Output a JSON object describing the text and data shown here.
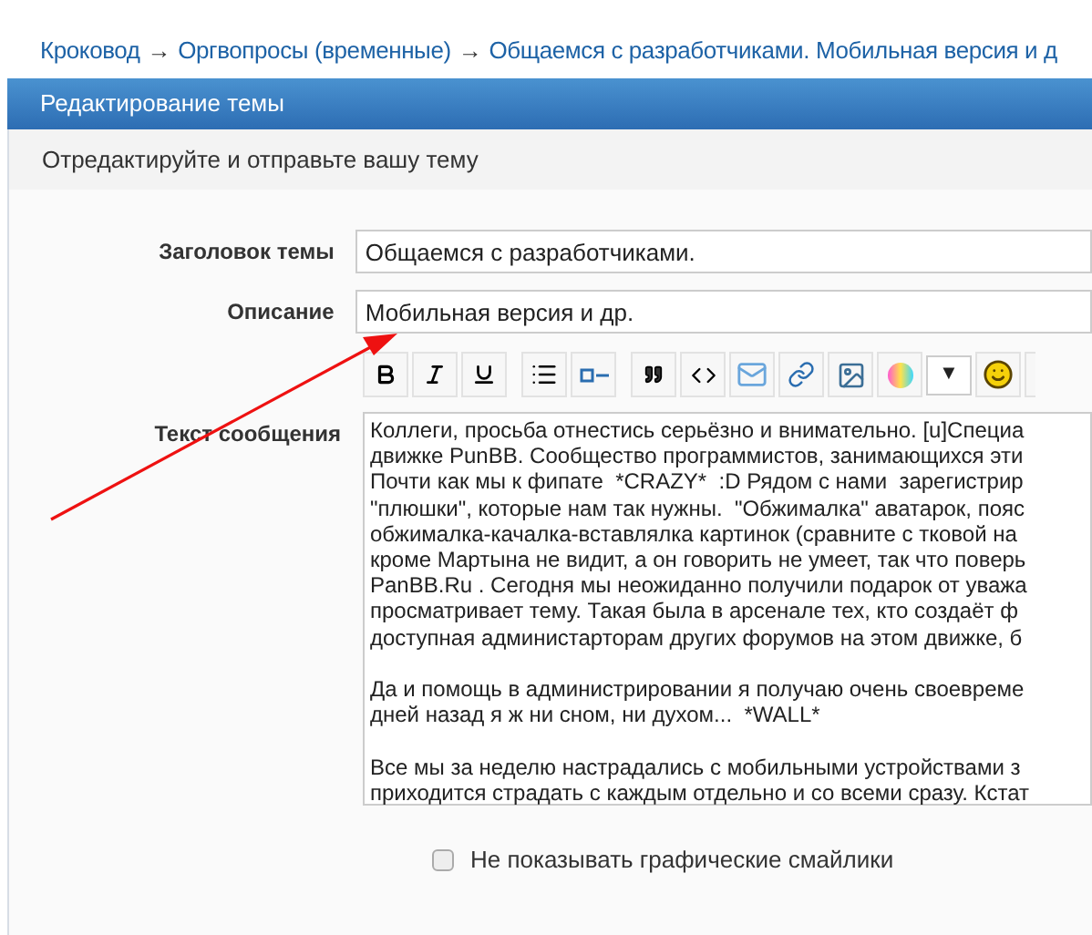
{
  "breadcrumbs": [
    "Кроковод",
    "Оргвопросы (временные)",
    "Общаемся с разработчиками. Мобильная версия и д"
  ],
  "breadcrumb_separator": "→",
  "panel": {
    "title": "Редактирование темы",
    "subtitle": "Отредактируйте и отправьте вашу тему"
  },
  "form": {
    "subject": {
      "label": "Заголовок темы",
      "value": "Общаемся с разработчиками."
    },
    "description": {
      "label": "Описание",
      "value": "Мобильная версия и др."
    },
    "toolbar": {
      "dropdown": "▼"
    },
    "message": {
      "label": "Текст сообщения",
      "paragraphs": [
        [
          "Коллеги, просьба отнестись серьёзно и внимательно. [u]Специа",
          "движке PunBB. Сообщество программистов, занимающихся эти",
          "Почти как мы к фипате  *CRAZY*  :D Рядом с нами  зарегистрир",
          "\"плюшки\", которые нам так нужны.  \"Обжималка\" аватарок, пояс",
          "обжималка-качалка-вставлялка картинок (сравните с тковой на",
          "кроме Мартына не видит, а он говорить не умеет, так что поверь",
          "PanBB.Ru . Сегодня мы неожиданно получили подарок от уважа",
          "просматривает тему. Такая была в арсенале тех, кто создаёт ф",
          "доступная администарторам других форумов на этом движке, б"
        ],
        [
          "Да и помощь в администрировании я получаю очень своевреме",
          "дней назад я ж ни сном, ни духом...  *WALL*"
        ],
        [
          "Все мы за неделю настрадались с мобильными устройствами з",
          "приходится страдать с каждым отдельно и со всеми сразу. Кстат"
        ]
      ]
    },
    "hide_smilies": {
      "label": "Не показывать графические смайлики",
      "checked": false
    }
  }
}
